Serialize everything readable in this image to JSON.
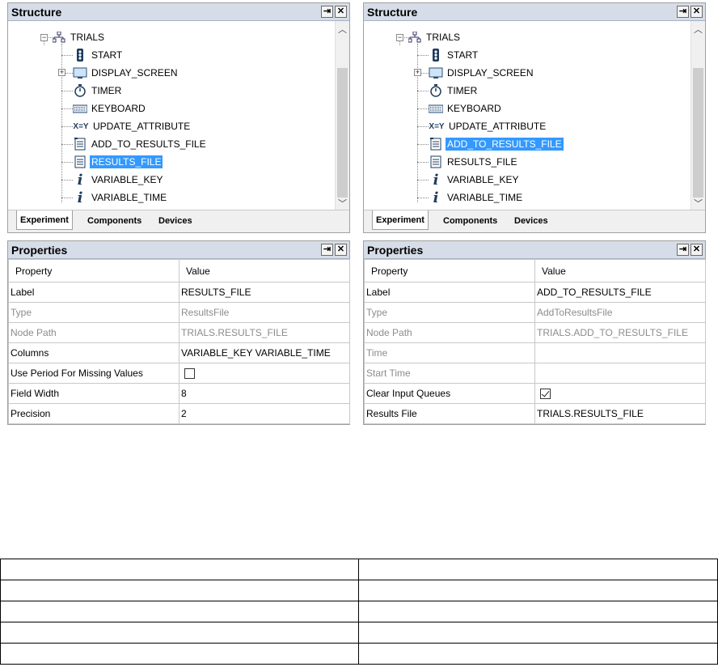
{
  "structure": {
    "title": "Structure",
    "root": "TRIALS",
    "items": [
      "START",
      "DISPLAY_SCREEN",
      "TIMER",
      "KEYBOARD",
      "UPDATE_ATTRIBUTE",
      "ADD_TO_RESULTS_FILE",
      "RESULTS_FILE",
      "VARIABLE_KEY",
      "VARIABLE_TIME"
    ],
    "tabs": [
      "Experiment",
      "Components",
      "Devices"
    ],
    "pin_glyph": "⇥",
    "close_glyph": "✕"
  },
  "properties": {
    "title": "Properties",
    "col_property": "Property",
    "col_value": "Value"
  },
  "left_props": {
    "rows": [
      {
        "name": "Label",
        "value": "RESULTS_FILE"
      },
      {
        "name": "Type",
        "value": "ResultsFile"
      },
      {
        "name": "Node Path",
        "value": "TRIALS.RESULTS_FILE"
      },
      {
        "name": "Columns",
        "value": "VARIABLE_KEY VARIABLE_TIME"
      },
      {
        "name": "Use Period For Missing Values",
        "value": ""
      },
      {
        "name": "Field Width",
        "value": "8"
      },
      {
        "name": "Precision",
        "value": "2"
      }
    ]
  },
  "right_props": {
    "rows": [
      {
        "name": "Label",
        "value": "ADD_TO_RESULTS_FILE"
      },
      {
        "name": "Type",
        "value": "AddToResultsFile"
      },
      {
        "name": "Node Path",
        "value": "TRIALS.ADD_TO_RESULTS_FILE"
      },
      {
        "name": "Time",
        "value": ""
      },
      {
        "name": "Start Time",
        "value": ""
      },
      {
        "name": "Clear Input Queues",
        "value": ""
      },
      {
        "name": "Results File",
        "value": "TRIALS.RESULTS_FILE"
      }
    ]
  },
  "colors": {
    "selection": "#3399ff",
    "titlebar": "#d6dde8"
  }
}
